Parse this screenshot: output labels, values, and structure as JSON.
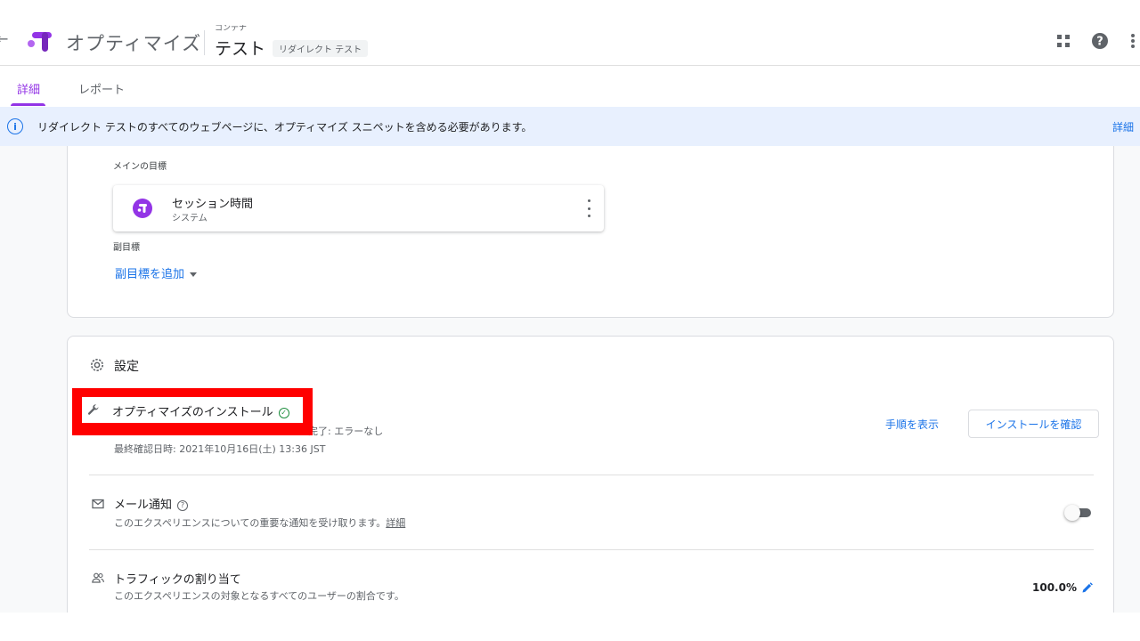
{
  "header": {
    "app_name": "オプティマイズ",
    "container_label": "コンテナ",
    "experience_name": "テスト",
    "experience_type": "リダイレクト テスト",
    "icons": [
      "arrow-back-icon",
      "optimize-logo-icon",
      "apps-grid-icon",
      "help-icon",
      "more-vert-icon"
    ]
  },
  "tabs": [
    {
      "label": "詳細",
      "active": true
    },
    {
      "label": "レポート",
      "active": false
    }
  ],
  "banner": {
    "text": "リダイレクト テストのすべてのウェブページに、オプティマイズ スニペットを含める必要があります。",
    "link": "詳細"
  },
  "goals": {
    "primary_label": "メインの目標",
    "primary_goal": {
      "title": "セッション時間",
      "subtitle": "システム"
    },
    "secondary_label": "副目標",
    "add_secondary": "副目標を追加"
  },
  "settings": {
    "title": "設定",
    "install": {
      "title": "オプティマイズのインストール",
      "status": "インストール完了: エラーなし",
      "status_visible": "完了: エラーなし",
      "last_checked": "最終確認日時: 2021年10月16日(土) 13:36 JST",
      "show_steps": "手順を表示",
      "verify_button": "インストールを確認"
    },
    "email": {
      "title": "メール通知",
      "help": "?",
      "description": "このエクスペリエンスについての重要な通知を受け取ります。",
      "link": "詳細",
      "enabled": false
    },
    "traffic": {
      "title": "トラフィックの割り当て",
      "description": "このエクスペリエンスの対象となるすべてのユーザーの割合です。",
      "value": "100.0%"
    }
  },
  "colors": {
    "accent": "#9334e6",
    "link": "#1a73e8",
    "banner_bg": "#e8f0fe",
    "highlight": "#ff0000",
    "success": "#1e8e3e"
  }
}
